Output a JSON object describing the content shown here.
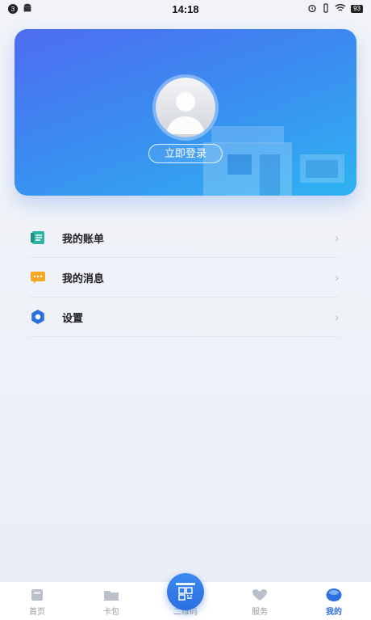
{
  "status_bar": {
    "notification_count": "3",
    "time": "14:18",
    "battery": "93"
  },
  "hero": {
    "login_label": "立即登录"
  },
  "menu": [
    {
      "label": "我的账单",
      "icon": "bill-icon",
      "color": "#2bb3a3"
    },
    {
      "label": "我的消息",
      "icon": "message-icon",
      "color": "#f5a623"
    },
    {
      "label": "设置",
      "icon": "settings-icon",
      "color": "#2b6fe0"
    }
  ],
  "bottom_nav": [
    {
      "label": "首页",
      "icon": "home-icon",
      "active": false
    },
    {
      "label": "卡包",
      "icon": "wallet-icon",
      "active": false
    },
    {
      "label": "二维码",
      "icon": "qr-code-icon",
      "active": false
    },
    {
      "label": "服务",
      "icon": "service-icon",
      "active": false
    },
    {
      "label": "我的",
      "icon": "profile-icon",
      "active": true
    }
  ],
  "colors": {
    "accent": "#2b6fe0",
    "card_gradient_start": "#4f6cf2",
    "card_gradient_end": "#2fb3f2"
  }
}
